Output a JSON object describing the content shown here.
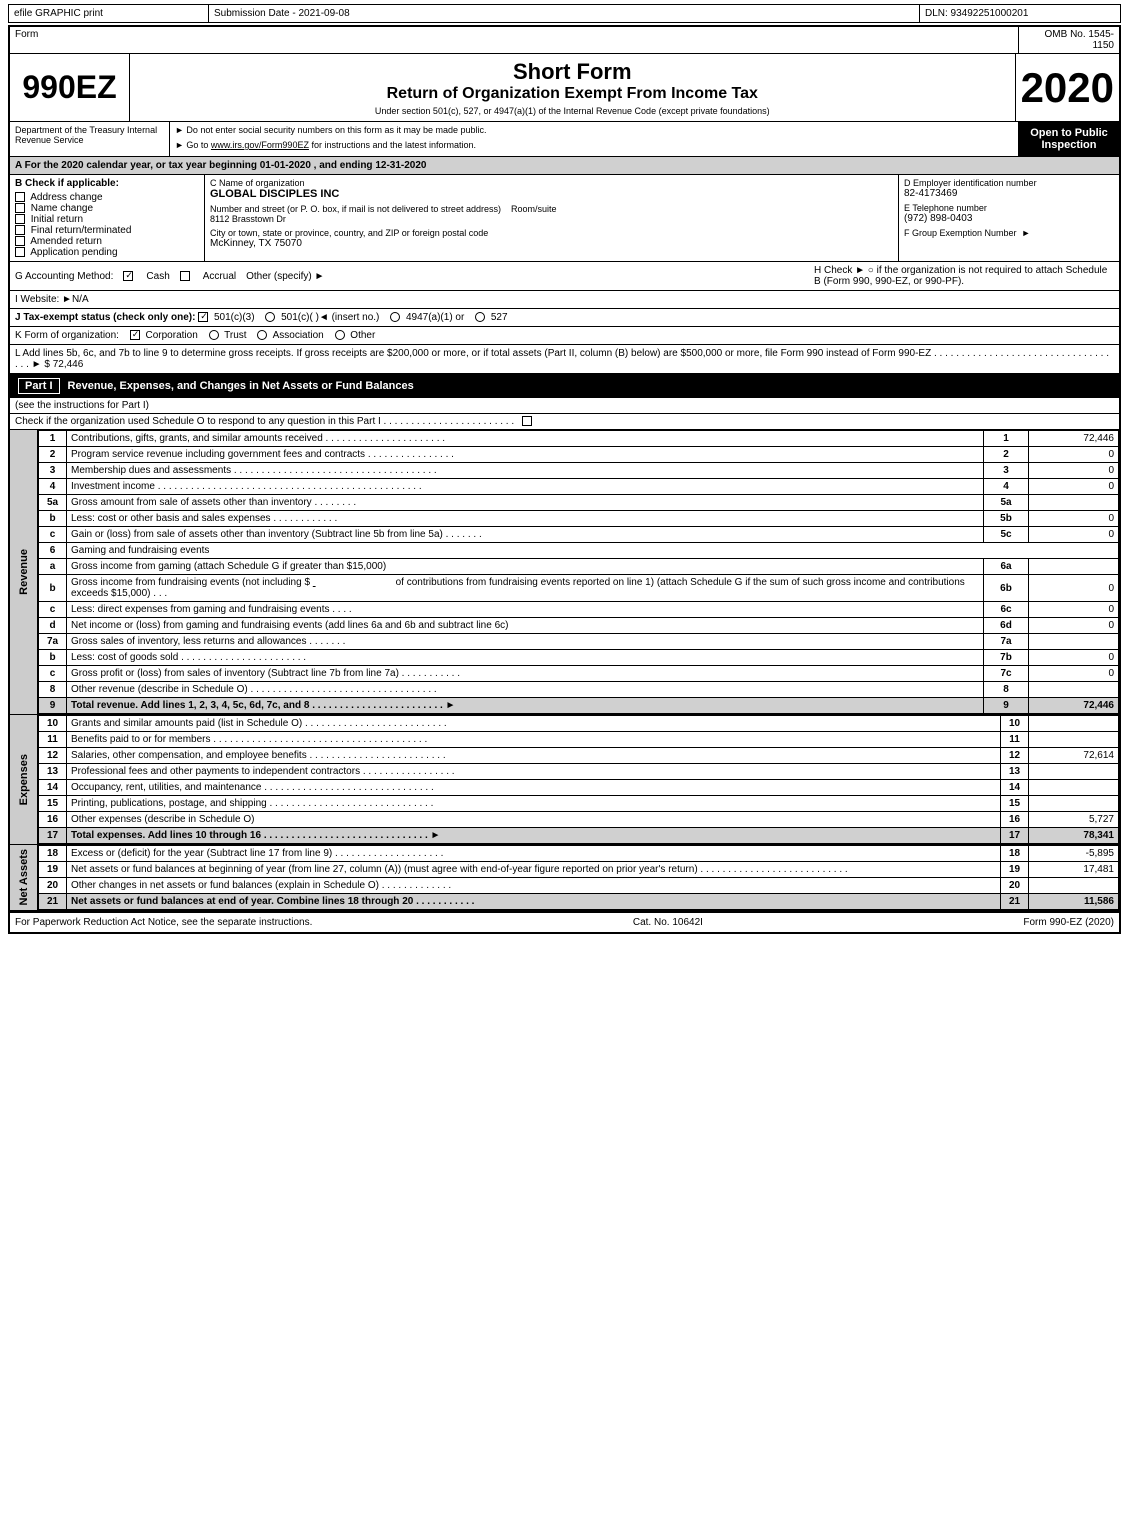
{
  "header": {
    "efile": "efile GRAPHIC print",
    "submission_date_label": "Submission Date - 2021-09-08",
    "dln": "DLN: 93492251000201"
  },
  "form": {
    "omb": "OMB No. 1545-1150",
    "number": "990EZ",
    "title1": "Short Form",
    "title2": "Return of Organization Exempt From Income Tax",
    "subtitle": "Under section 501(c), 527, or 4947(a)(1) of the Internal Revenue Code (except private foundations)",
    "notice1": "► Do not enter social security numbers on this form as it may be made public.",
    "notice2": "► Go to www.irs.gov/Form990EZ for instructions and the latest information.",
    "year": "2020",
    "open_to_public": "Open to Public Inspection",
    "department": "Department of the Treasury Internal Revenue Service",
    "section_a": "A  For the 2020 calendar year, or tax year beginning 01-01-2020 , and ending 12-31-2020",
    "check_b_label": "B  Check if applicable:",
    "check_b_items": [
      {
        "label": "Address change",
        "checked": false
      },
      {
        "label": "Name change",
        "checked": false
      },
      {
        "label": "Initial return",
        "checked": false
      },
      {
        "label": "Final return/terminated",
        "checked": false
      },
      {
        "label": "Amended return",
        "checked": false
      },
      {
        "label": "Application pending",
        "checked": false
      }
    ],
    "c_label": "C Name of organization",
    "c_value": "GLOBAL DISCIPLES INC",
    "address_label": "Number and street (or P. O. box, if mail is not delivered to street address)",
    "address_value": "8112 Brasstown Dr",
    "room_suite_label": "Room/suite",
    "room_suite_value": "",
    "city_label": "City or town, state or province, country, and ZIP or foreign postal code",
    "city_value": "McKinney, TX  75070",
    "d_label": "D Employer identification number",
    "d_value": "82-4173469",
    "e_label": "E Telephone number",
    "e_value": "(972) 898-0403",
    "f_label": "F Group Exemption Number",
    "f_value": "",
    "g_label": "G Accounting Method:",
    "g_cash": "Cash",
    "g_cash_checked": true,
    "g_accrual": "Accrual",
    "g_accrual_checked": false,
    "g_other": "Other (specify) ►",
    "h_label": "H  Check ► ○ if the organization is not required to attach Schedule B (Form 990, 990-EZ, or 990-PF).",
    "i_label": "I Website: ►N/A",
    "j_label": "J Tax-exempt status (check only one):",
    "j_501c3": "501(c)(3)",
    "j_501c3_checked": true,
    "j_501c": "501(c)(  )◄ (insert no.)",
    "j_4947": "4947(a)(1) or",
    "j_527": "527",
    "k_label": "K Form of organization:",
    "k_corp": "Corporation",
    "k_corp_checked": true,
    "k_trust": "Trust",
    "k_assoc": "Association",
    "k_other": "Other",
    "l_text": "L Add lines 5b, 6c, and 7b to line 9 to determine gross receipts. If gross receipts are $200,000 or more, or if total assets (Part II, column (B) below) are $500,000 or more, file Form 990 instead of Form 990-EZ . . . . . . . . . . . . . . . . . . . . . . . . . . . . . . . . . . . ► $",
    "l_value": "72,446"
  },
  "part1": {
    "title": "Revenue, Expenses, and Changes in Net Assets or Fund Balances",
    "subtitle": "(see the instructions for Part I)",
    "check_label": "Check if the organization used Schedule O to respond to any question in this Part I . . . . . . . . . . . . . . . . . . . . . . . .",
    "revenue_label": "Revenue",
    "lines": [
      {
        "num": "1",
        "desc": "Contributions, gifts, grants, and similar amounts received . . . . . . . . . . . . . . . . . . . . . .",
        "linenum": "1",
        "amount": "72,446"
      },
      {
        "num": "2",
        "desc": "Program service revenue including government fees and contracts . . . . . . . . . . . . . . . .",
        "linenum": "2",
        "amount": "0"
      },
      {
        "num": "3",
        "desc": "Membership dues and assessments . . . . . . . . . . . . . . . . . . . . . . . . . . . . . . . . . . . . .",
        "linenum": "3",
        "amount": "0"
      },
      {
        "num": "4",
        "desc": "Investment income . . . . . . . . . . . . . . . . . . . . . . . . . . . . . . . . . . . . . . . . . . . . . . . .",
        "linenum": "4",
        "amount": "0"
      }
    ],
    "line5a_desc": "Gross amount from sale of assets other than inventory . . . . . . . .",
    "line5a_sub": "5a",
    "line5a_amount": "",
    "line5b_desc": "Less: cost or other basis and sales expenses . . . . . . . . . . . .",
    "line5b_sub": "5b",
    "line5b_amount": "0",
    "line5c_desc": "Gain or (loss) from sale of assets other than inventory (Subtract line 5b from line 5a) . . . . . . .",
    "line5c_num": "5c",
    "line5c_amount": "0",
    "line6_desc": "Gaming and fundraising events",
    "line6a_desc": "Gross income from gaming (attach Schedule G if greater than $15,000)",
    "line6a_sub": "6a",
    "line6a_amount": "",
    "line6b_desc1": "Gross income from fundraising events (not including $",
    "line6b_desc2": "of contributions from fundraising events reported on line 1) (attach Schedule G if the sum of such gross income and contributions exceeds $15,000) . . .",
    "line6b_sub": "6b",
    "line6b_amount": "0",
    "line6c_desc": "Less: direct expenses from gaming and fundraising events . . . .",
    "line6c_sub": "6c",
    "line6c_amount": "0",
    "line6d_desc": "Net income or (loss) from gaming and fundraising events (add lines 6a and 6b and subtract line 6c)",
    "line6d_num": "6d",
    "line6d_amount": "0",
    "line7a_desc": "Gross sales of inventory, less returns and allowances . . . . . . .",
    "line7a_sub": "7a",
    "line7a_amount": "",
    "line7b_desc": "Less: cost of goods sold . . . . . . . . . . . . . . . . . . . . . . .",
    "line7b_sub": "7b",
    "line7b_amount": "0",
    "line7c_desc": "Gross profit or (loss) from sales of inventory (Subtract line 7b from line 7a) . . . . . . . . . . .",
    "line7c_num": "7c",
    "line7c_amount": "0",
    "line8_desc": "Other revenue (describe in Schedule O) . . . . . . . . . . . . . . . . . . . . . . . . . . . . . . . . . .",
    "line8_num": "8",
    "line8_amount": "",
    "line9_desc": "Total revenue. Add lines 1, 2, 3, 4, 5c, 6d, 7c, and 8 . . . . . . . . . . . . . . . . . . . . . . . . ►",
    "line9_num": "9",
    "line9_amount": "72,446",
    "expenses_label": "Expenses",
    "line10_desc": "Grants and similar amounts paid (list in Schedule O) . . . . . . . . . . . . . . . . . . . . . . . . . .",
    "line10_num": "10",
    "line10_amount": "",
    "line11_desc": "Benefits paid to or for members . . . . . . . . . . . . . . . . . . . . . . . . . . . . . . . . . . . . . . .",
    "line11_num": "11",
    "line11_amount": "",
    "line12_desc": "Salaries, other compensation, and employee benefits . . . . . . . . . . . . . . . . . . . . . . . . .",
    "line12_num": "12",
    "line12_amount": "72,614",
    "line13_desc": "Professional fees and other payments to independent contractors . . . . . . . . . . . . . . . . .",
    "line13_num": "13",
    "line13_amount": "",
    "line14_desc": "Occupancy, rent, utilities, and maintenance . . . . . . . . . . . . . . . . . . . . . . . . . . . . . . .",
    "line14_num": "14",
    "line14_amount": "",
    "line15_desc": "Printing, publications, postage, and shipping . . . . . . . . . . . . . . . . . . . . . . . . . . . . . .",
    "line15_num": "15",
    "line15_amount": "",
    "line16_desc": "Other expenses (describe in Schedule O)",
    "line16_num": "16",
    "line16_amount": "5,727",
    "line17_desc": "Total expenses. Add lines 10 through 16 . . . . . . . . . . . . . . . . . . . . . . . . . . . . . . ►",
    "line17_num": "17",
    "line17_amount": "78,341",
    "net_assets_label": "Net Assets",
    "line18_desc": "Excess or (deficit) for the year (Subtract line 17 from line 9) . . . . . . . . . . . . . . . . . . . .",
    "line18_num": "18",
    "line18_amount": "-5,895",
    "line19_desc": "Net assets or fund balances at beginning of year (from line 27, column (A)) (must agree with end-of-year figure reported on prior year's return) . . . . . . . . . . . . . . . . . . . . . . . . . . .",
    "line19_num": "19",
    "line19_amount": "17,481",
    "line20_desc": "Other changes in net assets or fund balances (explain in Schedule O) . . . . . . . . . . . . .",
    "line20_num": "20",
    "line20_amount": "",
    "line21_desc": "Net assets or fund balances at end of year. Combine lines 18 through 20 . . . . . . . . . . .",
    "line21_num": "21",
    "line21_amount": "11,586"
  },
  "footer": {
    "paperwork_notice": "For Paperwork Reduction Act Notice, see the separate instructions.",
    "cat_no": "Cat. No. 10642I",
    "form_label": "Form 990-EZ (2020)"
  }
}
